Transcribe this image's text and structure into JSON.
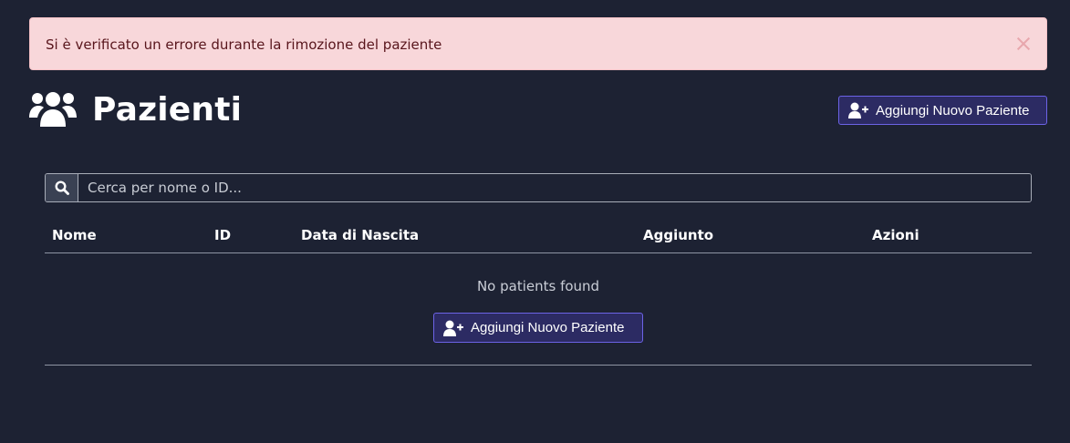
{
  "alert": {
    "message": "Si è verificato un errore durante la rimozione del paziente",
    "close_icon": "close-icon"
  },
  "header": {
    "icon": "users-icon",
    "title": "Pazienti",
    "add_button_icon": "user-plus-icon",
    "add_button_label": "Aggiungi Nuovo Paziente"
  },
  "search": {
    "icon": "search-icon",
    "placeholder": "Cerca per nome o ID...",
    "value": ""
  },
  "table": {
    "columns": [
      "Nome",
      "ID",
      "Data di Nascita",
      "Aggiunto",
      "Azioni"
    ],
    "empty_message": "No patients found",
    "empty_add_label": "Aggiungi Nuovo Paziente"
  },
  "colors": {
    "background": "#1d2233",
    "alert_bg": "#f8d7da",
    "alert_text": "#58151c",
    "button_bg": "#2c2b63",
    "button_border": "#6c63e6"
  }
}
